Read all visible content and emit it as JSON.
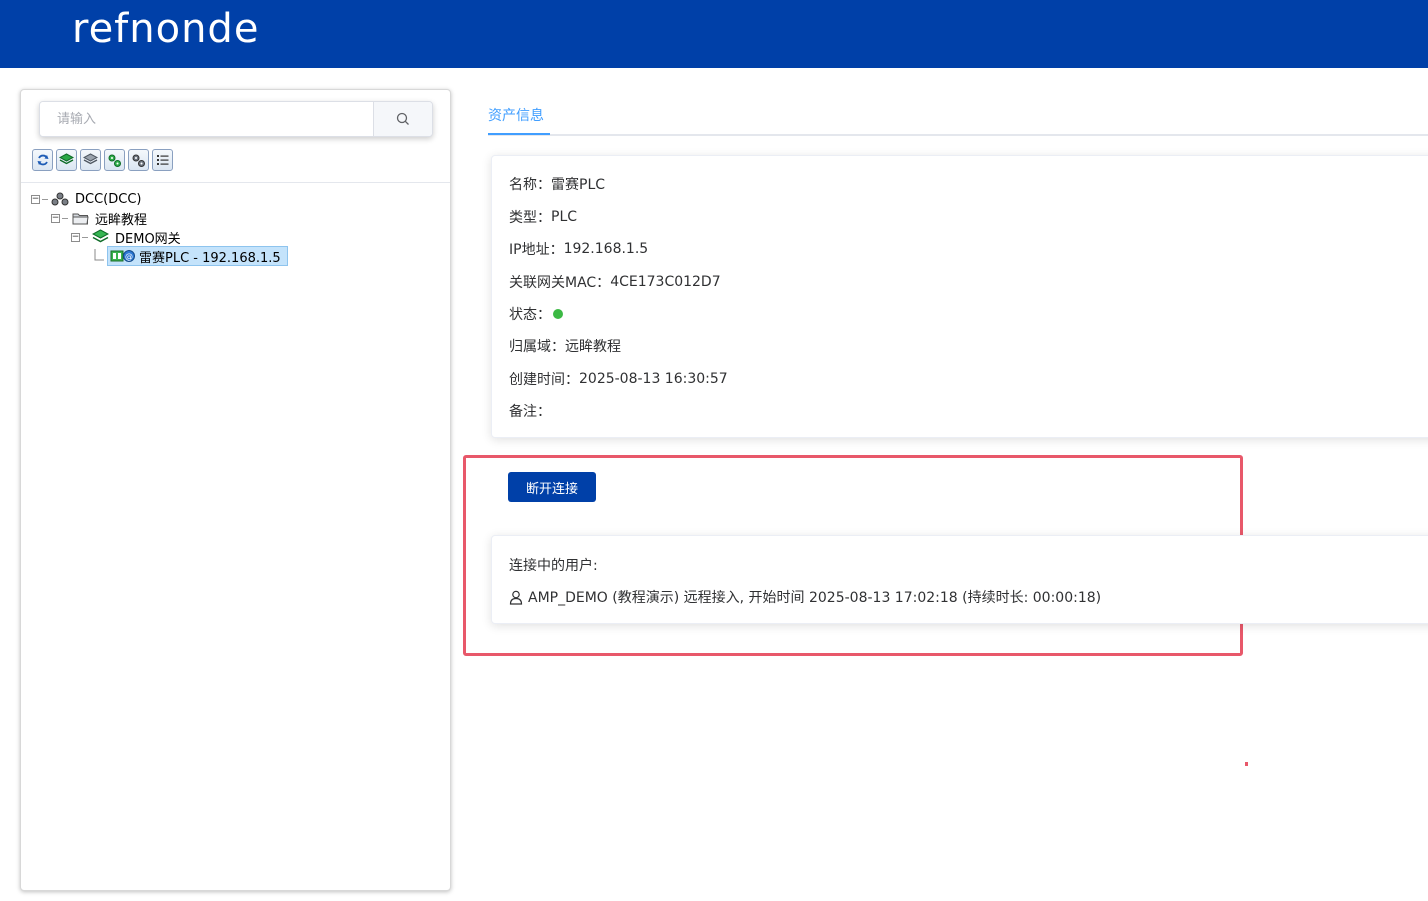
{
  "header": {
    "logo_text": "refnonde",
    "bg_color": "#0040a8"
  },
  "sidebar": {
    "search": {
      "placeholder": "请输入",
      "value": ""
    },
    "toolbar": [
      {
        "name": "refresh-icon"
      },
      {
        "name": "green-layer-icon"
      },
      {
        "name": "gray-layer-icon"
      },
      {
        "name": "green-gear-icon"
      },
      {
        "name": "gear-icon"
      },
      {
        "name": "list-icon"
      }
    ],
    "tree": [
      {
        "label": "DCC(DCC)",
        "icon": "cluster-icon",
        "level": 0
      },
      {
        "label": "远眸教程",
        "icon": "folder-icon",
        "level": 1
      },
      {
        "label": "DEMO网关",
        "icon": "gateway-icon",
        "level": 2
      },
      {
        "label": "雷赛PLC - 192.168.1.5",
        "icon": "plc-icon",
        "level": 3,
        "selected": true
      }
    ]
  },
  "main": {
    "tab_label": "资产信息",
    "accent_color": "#409eff",
    "info": {
      "name_label": "名称：",
      "name": "雷赛PLC",
      "type_label": "类型：",
      "type": "PLC",
      "ip_label": "IP地址：",
      "ip": "192.168.1.5",
      "mac_label": "关联网关MAC：",
      "mac": "4CE173C012D7",
      "status_label": "状态：",
      "status_color": "#3cb944",
      "domain_label": "归属域：",
      "domain": "远眸教程",
      "created_label": "创建时间：",
      "created": "2025-08-13 16:30:57",
      "note_label": "备注：",
      "note": ""
    },
    "disconnect_label": "断开连接",
    "users_title": "连接中的用户:",
    "connected_user": "AMP_DEMO (教程演示) 远程接入, 开始时间 2025-08-13 17:02:18 (持续时长: 00:00:18)",
    "highlight_color": "#e8586a"
  }
}
